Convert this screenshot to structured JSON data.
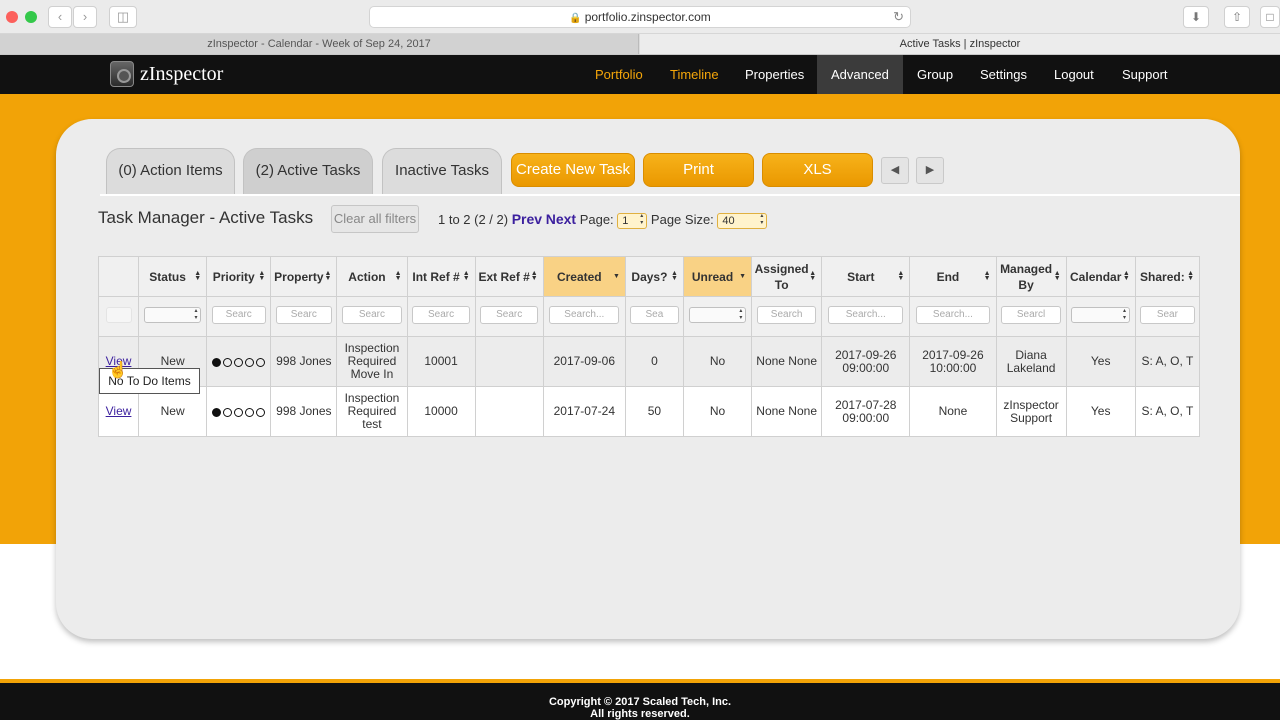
{
  "browser": {
    "url": "portfolio.zinspector.com",
    "tabs": [
      {
        "title": "zInspector - Calendar - Week of Sep 24, 2017"
      },
      {
        "title": "Active Tasks | zInspector"
      }
    ]
  },
  "app": {
    "logo": "zInspector",
    "nav": [
      {
        "label": "Portfolio",
        "state": "gold"
      },
      {
        "label": "Timeline",
        "state": "gold"
      },
      {
        "label": "Properties",
        "state": ""
      },
      {
        "label": "Advanced",
        "state": "active"
      },
      {
        "label": "Group",
        "state": ""
      },
      {
        "label": "Settings",
        "state": ""
      },
      {
        "label": "Logout",
        "state": ""
      },
      {
        "label": "Support",
        "state": ""
      }
    ]
  },
  "tabs": {
    "action_items": "(0) Action Items",
    "active_tasks": "(2) Active Tasks",
    "inactive_tasks": "Inactive Tasks"
  },
  "buttons": {
    "create": "Create New Task",
    "print": "Print",
    "xls": "XLS",
    "prev_icon": "triangle-left-icon",
    "next_icon": "triangle-right-icon"
  },
  "header": {
    "title": "Task Manager - Active Tasks",
    "clear_filters": "Clear all filters",
    "range": "1 to 2 (2 / 2)",
    "prev": "Prev",
    "next": "Next",
    "page_label": "Page:",
    "page_value": "1",
    "page_size_label": "Page Size:",
    "page_size_value": "40"
  },
  "table": {
    "columns": [
      "",
      "Status",
      "Priority",
      "Property",
      "Action",
      "Int Ref #",
      "Ext Ref #",
      "Created",
      "Days?",
      "Unread",
      "Assigned To",
      "Start",
      "End",
      "Managed By",
      "Calendar",
      "Shared:"
    ],
    "filter_placeholders": [
      "",
      "",
      "Searc",
      "Searc",
      "Searc",
      "Searc",
      "Searc",
      "Search...",
      "Sea",
      "",
      "Search",
      "Search...",
      "Search...",
      "Searcl",
      "",
      "Sear"
    ],
    "rows": [
      {
        "view": "View",
        "status": "New",
        "priority_filled": 1,
        "priority_total": 5,
        "property": "998 Jones",
        "action": "Inspection Required Move In",
        "int_ref": "10001",
        "ext_ref": "",
        "created": "2017-09-06",
        "days": "0",
        "unread": "No",
        "assigned": "None None",
        "start": "2017-09-26 09:00:00",
        "end": "2017-09-26 10:00:00",
        "managed_by": "Diana Lakeland",
        "calendar": "Yes",
        "shared": "S: A, O, T"
      },
      {
        "view": "View",
        "status": "New",
        "priority_filled": 1,
        "priority_total": 5,
        "property": "998 Jones",
        "action": "Inspection Required test",
        "int_ref": "10000",
        "ext_ref": "",
        "created": "2017-07-24",
        "days": "50",
        "unread": "No",
        "assigned": "None None",
        "start": "2017-07-28 09:00:00",
        "end": "None",
        "managed_by": "zInspector Support",
        "calendar": "Yes",
        "shared": "S: A, O, T"
      }
    ]
  },
  "tooltip": "No To Do Items",
  "footer": {
    "line1": "Copyright © 2017 Scaled Tech, Inc.",
    "line2": "All rights reserved."
  },
  "colors": {
    "accent": "#f2a307",
    "link": "#3b1f9e",
    "highlight_header": "#f9d285"
  }
}
